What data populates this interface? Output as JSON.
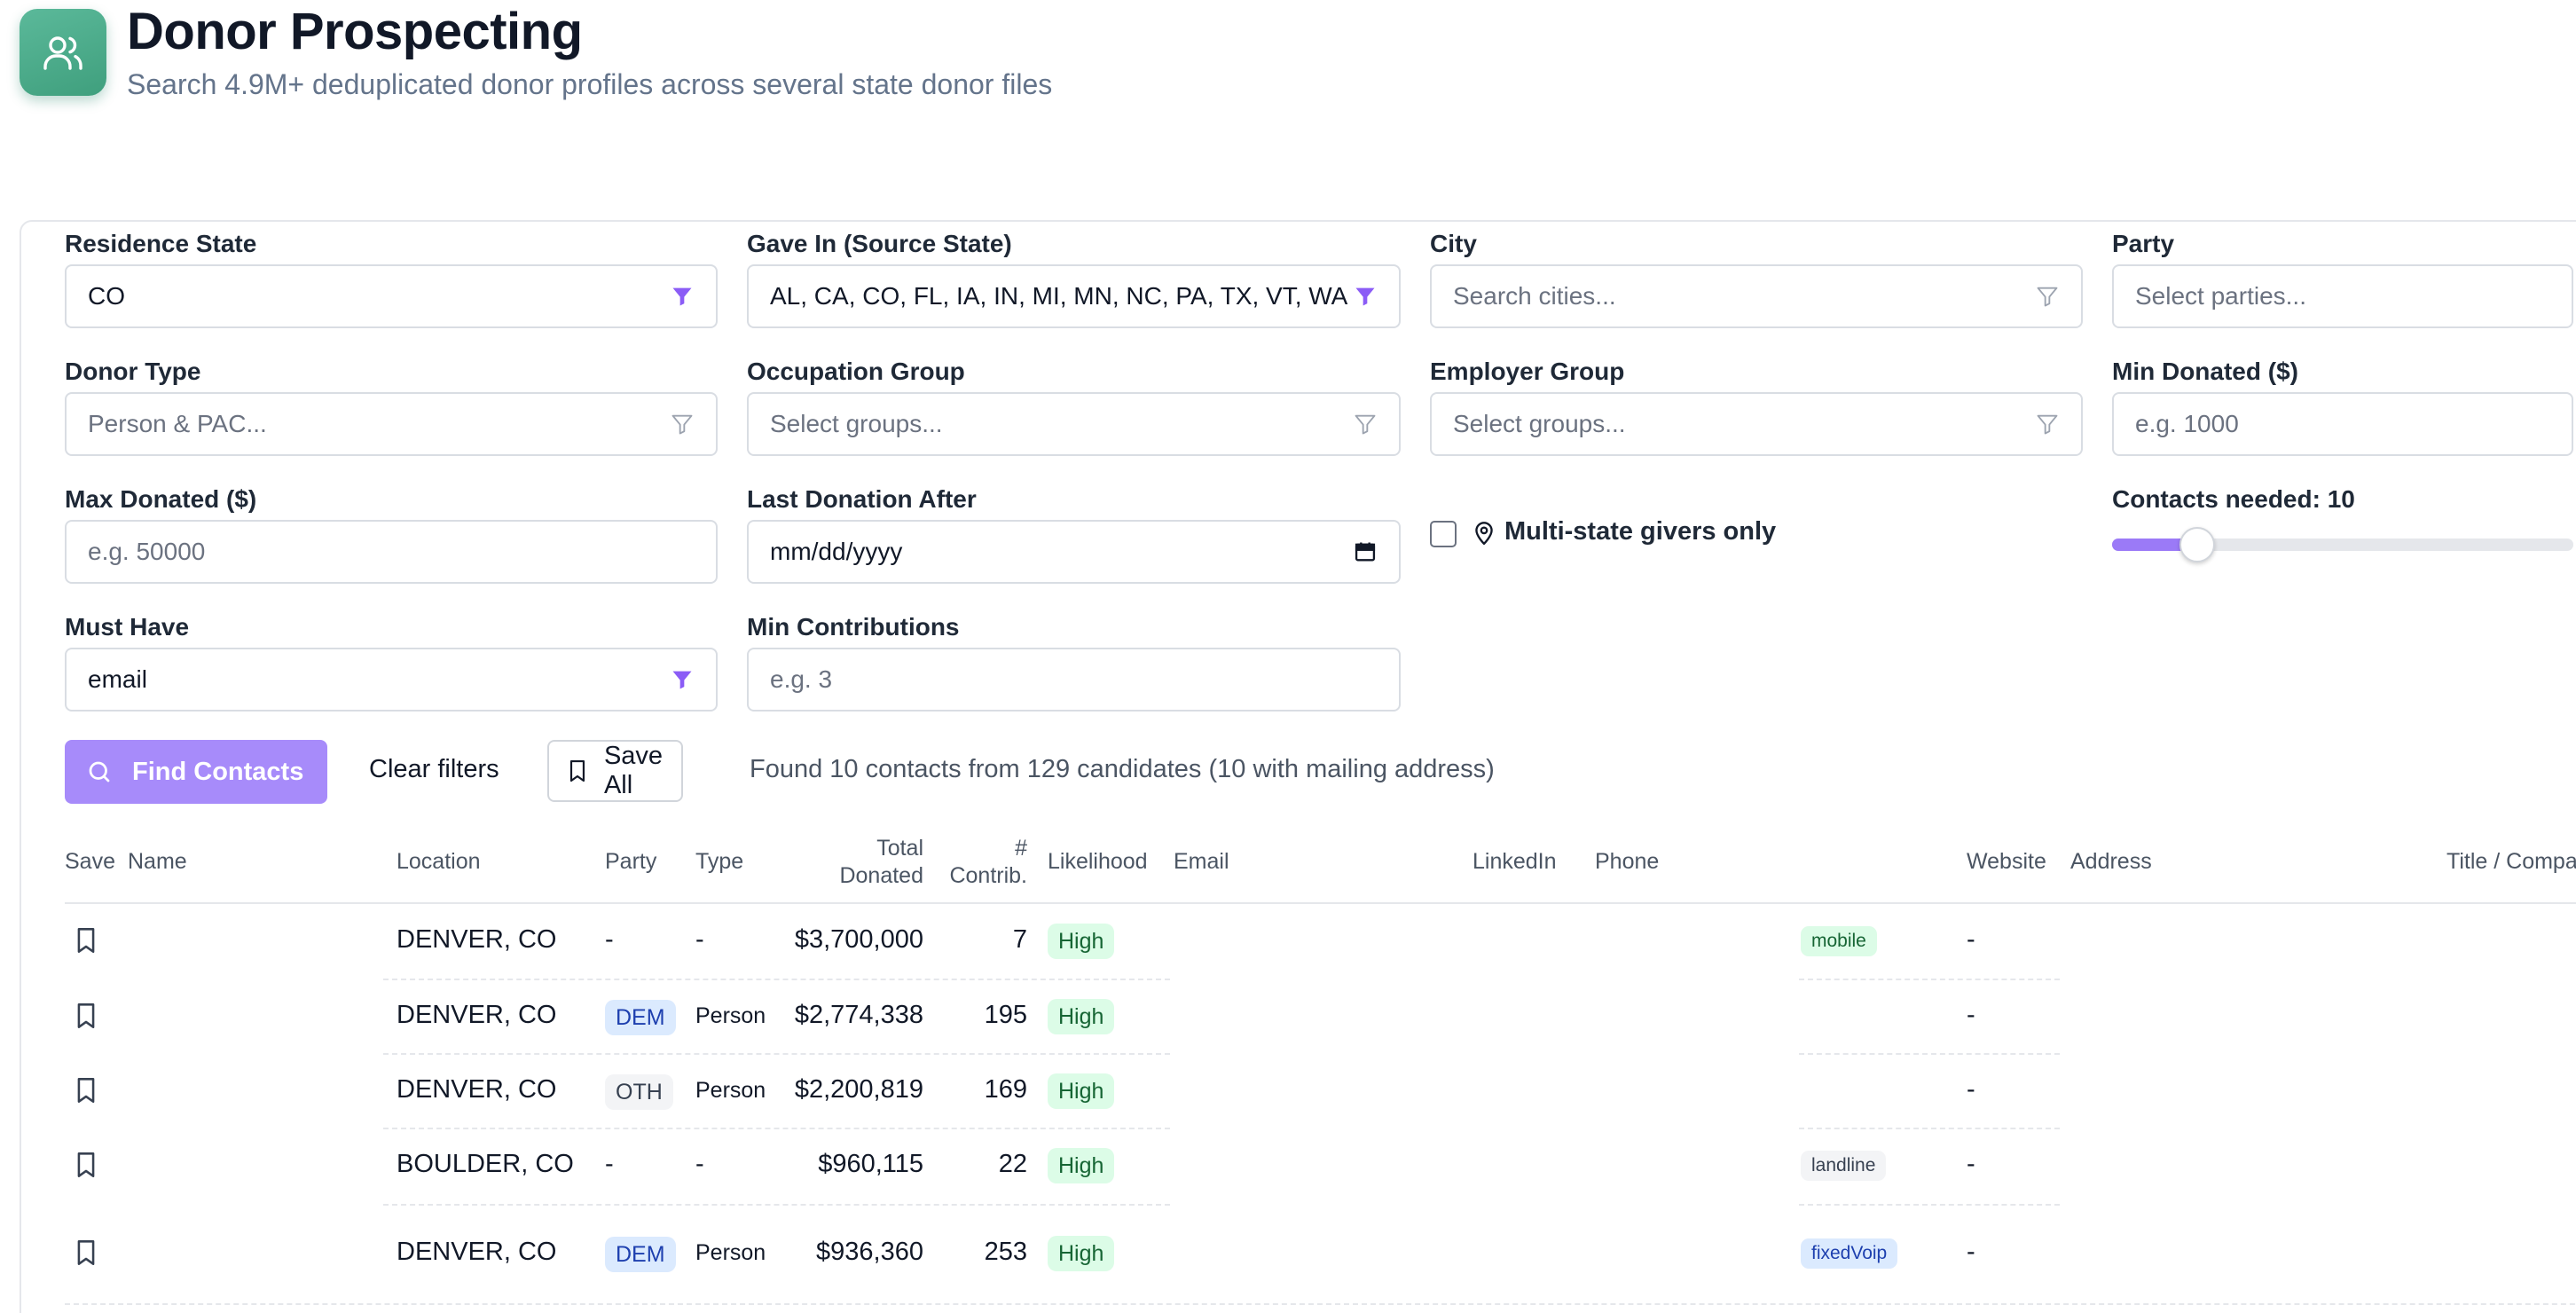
{
  "header": {
    "title": "Donor Prospecting",
    "subtitle": "Search 4.9M+ deduplicated donor profiles across several state donor files",
    "icon": "users-icon"
  },
  "filters": {
    "residence_state": {
      "label": "Residence State",
      "value": "CO"
    },
    "gave_in": {
      "label": "Gave In (Source State)",
      "value": "AL, CA, CO, FL, IA, IN, MI, MN, NC, PA, TX, VT, WA"
    },
    "city": {
      "label": "City",
      "placeholder": "Search cities..."
    },
    "party": {
      "label": "Party",
      "placeholder": "Select parties..."
    },
    "donor_type": {
      "label": "Donor Type",
      "placeholder": "Person & PAC..."
    },
    "occupation_group": {
      "label": "Occupation Group",
      "placeholder": "Select groups..."
    },
    "employer_group": {
      "label": "Employer Group",
      "placeholder": "Select groups..."
    },
    "min_donated": {
      "label": "Min Donated ($)",
      "placeholder": "e.g. 1000"
    },
    "max_donated": {
      "label": "Max Donated ($)",
      "placeholder": "e.g. 50000"
    },
    "last_donation_after": {
      "label": "Last Donation After",
      "placeholder": "mm/dd/yyyy"
    },
    "multi_state": {
      "label": "Multi-state givers only",
      "checked": false
    },
    "contacts_needed": {
      "label": "Contacts needed: 10",
      "value": 10,
      "fill_fraction": 0.1
    },
    "must_have": {
      "label": "Must Have",
      "value": "email"
    },
    "min_contributions": {
      "label": "Min Contributions",
      "placeholder": "e.g. 3"
    }
  },
  "actions": {
    "find_contacts": "Find Contacts",
    "clear_filters": "Clear filters",
    "save_all": "Save All",
    "status": "Found 10 contacts from 129 candidates (10 with mailing address)"
  },
  "table": {
    "columns": {
      "save": "Save",
      "name": "Name",
      "location": "Location",
      "party": "Party",
      "type": "Type",
      "total_line1": "Total",
      "total_line2": "Donated",
      "contrib_line1": "#",
      "contrib_line2": "Contrib.",
      "likelihood": "Likelihood",
      "email": "Email",
      "linkedin": "LinkedIn",
      "phone": "Phone",
      "website": "Website",
      "address": "Address",
      "title_company": "Title / Company"
    },
    "rows": [
      {
        "location": "DENVER, CO",
        "party": "-",
        "type": "-",
        "total": "$3,700,000",
        "contrib": "7",
        "likelihood": "High",
        "phone_type": "mobile",
        "website": "-"
      },
      {
        "location": "DENVER, CO",
        "party": "DEM",
        "type": "Person",
        "total": "$2,774,338",
        "contrib": "195",
        "likelihood": "High",
        "phone_type": "",
        "website": "-"
      },
      {
        "location": "DENVER, CO",
        "party": "OTH",
        "type": "Person",
        "total": "$2,200,819",
        "contrib": "169",
        "likelihood": "High",
        "phone_type": "",
        "website": "-"
      },
      {
        "location": "BOULDER, CO",
        "party": "-",
        "type": "-",
        "total": "$960,115",
        "contrib": "22",
        "likelihood": "High",
        "phone_type": "landline",
        "website": "-"
      },
      {
        "location": "DENVER, CO",
        "party": "DEM",
        "type": "Person",
        "total": "$936,360",
        "contrib": "253",
        "likelihood": "High",
        "phone_type": "fixedVoip",
        "website": "-"
      }
    ]
  },
  "colors": {
    "accent": "#a78bfa",
    "brand_icon": "#4caf8c",
    "high_badge": "#dcfce7",
    "dem_badge": "#dbeafe"
  }
}
